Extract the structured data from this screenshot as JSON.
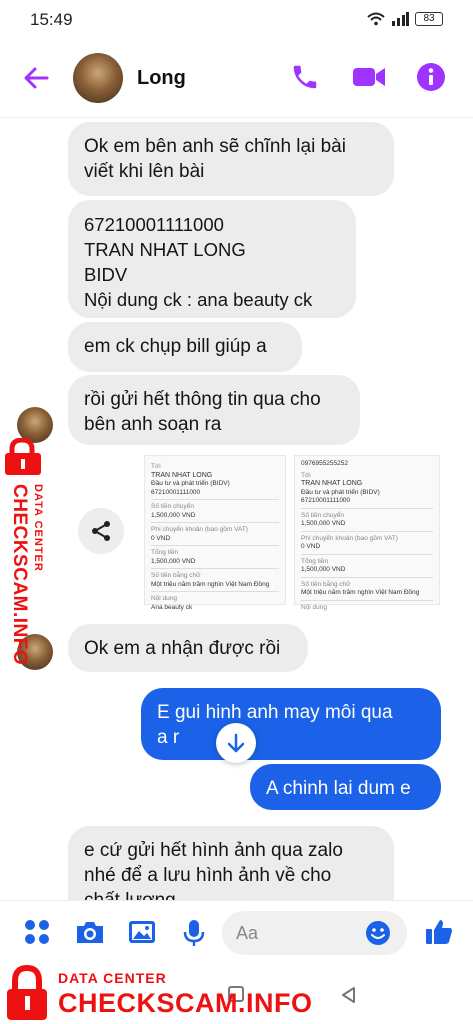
{
  "status": {
    "time": "15:49",
    "battery": "83"
  },
  "header": {
    "contact_name": "Long"
  },
  "messages": [
    {
      "text": "Ok em bên anh sẽ chĩnh lại bài\nviết khi lên bài"
    },
    {
      "text": "67210001111000\nTRAN NHAT LONG\nBIDV\nNội dung ck : ana beauty ck"
    },
    {
      "text": "em ck chụp bill giúp a"
    },
    {
      "text": "rồi gửi hết thông tin qua cho\nbên anh soạn ra"
    },
    {
      "text": "Ok em a nhận được rồi"
    },
    {
      "text": "E gui hinh anh may môi qua\na r"
    },
    {
      "text": "A chinh lai dum e"
    },
    {
      "text": "e cứ gửi hết hình ảnh qua zalo\nnhé để a lưu hình ảnh về cho\nchất lượng"
    }
  ],
  "receipts": [
    {
      "header": "Tới",
      "name": "TRAN NHAT LONG",
      "bank": "Đầu tư và phát triển (BIDV)",
      "account": "67210001111000",
      "amount_label": "Số tiền chuyển",
      "amount": "1,500,000 VND",
      "fee_label": "Phí chuyển khoản (bao gồm VAT)",
      "fee": "0 VND",
      "total_label": "Tổng tiền",
      "total": "1,500,000 VND",
      "words_label": "Số tiền bằng chữ",
      "words": "Một triệu năm trăm nghìn Việt Nam Đồng",
      "content_label": "Nội dung",
      "content": "Ana beauty ck"
    },
    {
      "top_number": "0976955255252",
      "header": "Tới",
      "name": "TRAN NHAT LONG",
      "bank": "Đầu tư và phát triển (BIDV)",
      "account": "67210001111000",
      "amount_label": "Số tiền chuyển",
      "amount": "1,500,000 VND",
      "fee_label": "Phí chuyển khoản (bao gồm VAT)",
      "fee": "0 VND",
      "total_label": "Tổng tiền",
      "total": "1,500,000 VND",
      "words_label": "Số tiền bằng chữ",
      "words": "Một triệu năm trăm nghìn Việt Nam Đồng",
      "content_label": "Nội dung"
    }
  ],
  "composer": {
    "placeholder": "Aa"
  },
  "watermark": {
    "line1": "DATA CENTER",
    "line2": "CHECKSCAM.INFO"
  },
  "colors": {
    "messenger_purple": "#a033ff",
    "messenger_blue": "#1b62e8",
    "watermark_red": "#e11111"
  },
  "icons": [
    "back-arrow-icon",
    "phone-icon",
    "video-icon",
    "info-icon",
    "share-icon",
    "arrow-down-icon",
    "apps-icon",
    "camera-icon",
    "image-icon",
    "mic-icon",
    "emoji-icon",
    "like-icon",
    "lock-icon"
  ]
}
